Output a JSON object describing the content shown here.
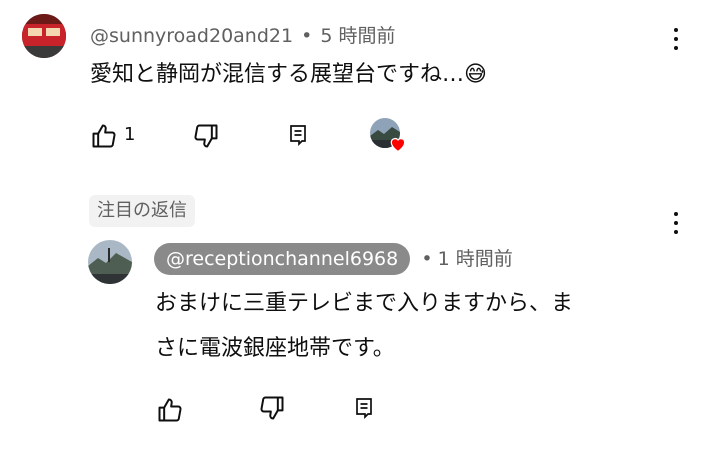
{
  "comment": {
    "handle": "@sunnyroad20and21",
    "separator": "•",
    "time": "5 時間前",
    "text": "愛知と静岡が混信する展望台ですね…",
    "emoji": "😅",
    "like_count": "1",
    "icons": [
      "thumbs-up-icon",
      "thumbs-down-icon",
      "reply-icon",
      "creator-heart-icon",
      "more-vert-icon"
    ]
  },
  "highlight_label": "注目の返信",
  "reply": {
    "handle": "@receptionchannel6968",
    "separator": "•",
    "time": "1 時間前",
    "text_line1": "おまけに三重テレビまで入りますから、ま",
    "text_line2": "さに電波銀座地帯です。",
    "icons": [
      "thumbs-up-icon",
      "thumbs-down-icon",
      "reply-icon",
      "more-vert-icon"
    ]
  },
  "colors": {
    "heart": "#ff0000",
    "muted_text": "#606060",
    "pill_bg": "#8a8a8a"
  }
}
